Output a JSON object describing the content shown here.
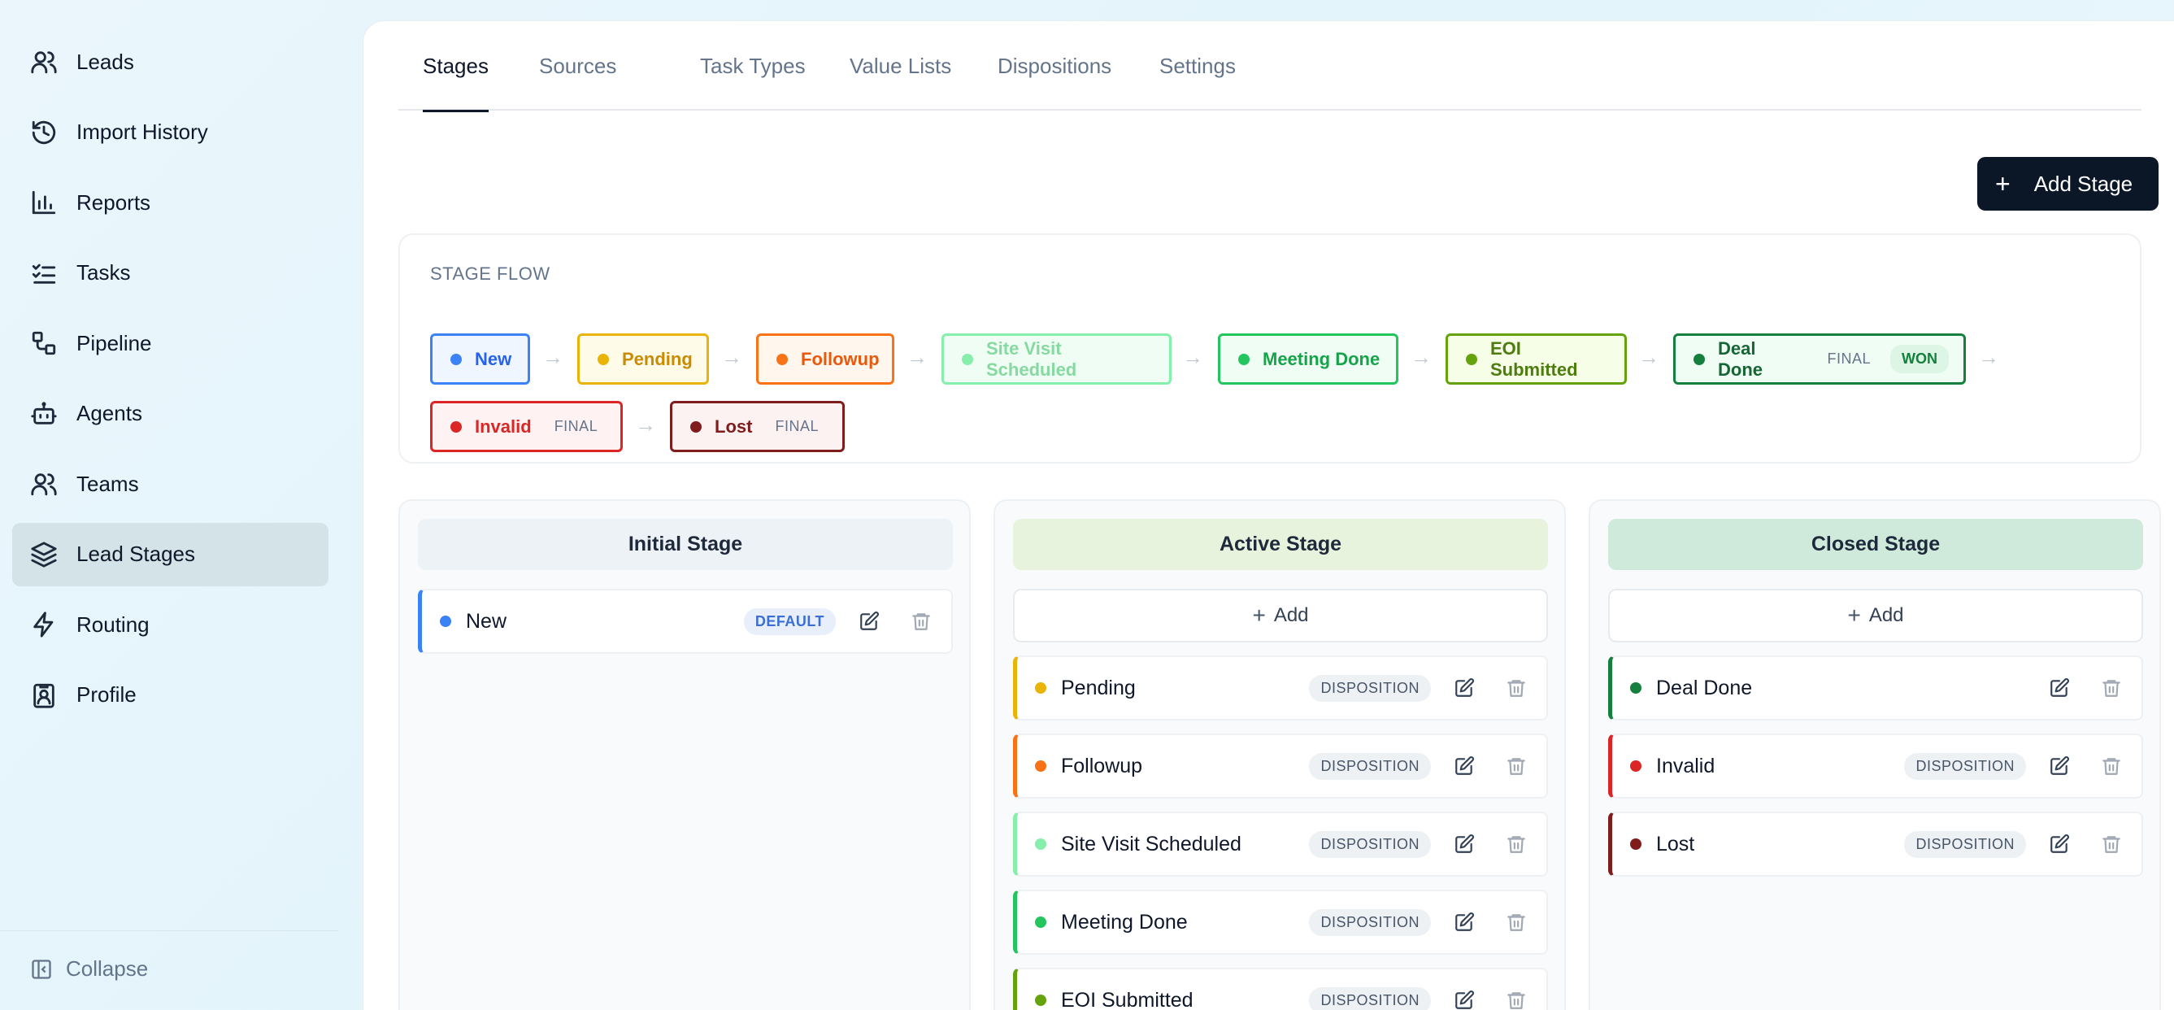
{
  "sidebar": {
    "items": [
      {
        "label": "Leads",
        "icon": "users-icon"
      },
      {
        "label": "Import History",
        "icon": "history-icon"
      },
      {
        "label": "Reports",
        "icon": "bar-chart-icon"
      },
      {
        "label": "Tasks",
        "icon": "list-checks-icon"
      },
      {
        "label": "Pipeline",
        "icon": "pipeline-icon"
      },
      {
        "label": "Agents",
        "icon": "bot-icon"
      },
      {
        "label": "Teams",
        "icon": "team-icon"
      },
      {
        "label": "Lead Stages",
        "icon": "layers-icon"
      },
      {
        "label": "Routing",
        "icon": "zap-icon"
      },
      {
        "label": "Profile",
        "icon": "id-badge-icon"
      }
    ],
    "active": "Lead Stages",
    "collapse_label": "Collapse"
  },
  "tabs": [
    "Stages",
    "Sources",
    "Task Types",
    "Value Lists",
    "Dispositions",
    "Settings"
  ],
  "active_tab": "Stages",
  "add_stage_label": "Add Stage",
  "flow": {
    "title": "STAGE FLOW",
    "stages": [
      {
        "label": "New",
        "color": "#3b82f6"
      },
      {
        "label": "Pending",
        "color": "#eab308"
      },
      {
        "label": "Followup",
        "color": "#f97316"
      },
      {
        "label": "Site Visit Scheduled",
        "color": "#86efac"
      },
      {
        "label": "Meeting Done",
        "color": "#22c55e"
      },
      {
        "label": "EOI Submitted",
        "color": "#65a30d"
      },
      {
        "label": "Deal Done",
        "color": "#15803d",
        "final": "FINAL",
        "won": "WON"
      },
      {
        "label": "Invalid",
        "color": "#dc2626",
        "final": "FINAL"
      },
      {
        "label": "Lost",
        "color": "#7f1d1d",
        "final": "FINAL"
      }
    ]
  },
  "columns": [
    {
      "title": "Initial Stage",
      "cards": [
        {
          "name": "New",
          "color": "#3b82f6",
          "badge": "DEFAULT"
        }
      ]
    },
    {
      "title": "Active Stage",
      "add_label": "Add",
      "cards": [
        {
          "name": "Pending",
          "color": "#eab308",
          "badge": "DISPOSITION"
        },
        {
          "name": "Followup",
          "color": "#f97316",
          "badge": "DISPOSITION"
        },
        {
          "name": "Site Visit Scheduled",
          "color": "#86efac",
          "badge": "DISPOSITION"
        },
        {
          "name": "Meeting Done",
          "color": "#22c55e",
          "badge": "DISPOSITION"
        },
        {
          "name": "EOI Submitted",
          "color": "#65a30d",
          "badge": "DISPOSITION"
        }
      ]
    },
    {
      "title": "Closed Stage",
      "add_label": "Add",
      "cards": [
        {
          "name": "Deal Done",
          "color": "#15803d"
        },
        {
          "name": "Invalid",
          "color": "#dc2626",
          "badge": "DISPOSITION"
        },
        {
          "name": "Lost",
          "color": "#7f1d1d",
          "badge": "DISPOSITION"
        }
      ]
    }
  ]
}
